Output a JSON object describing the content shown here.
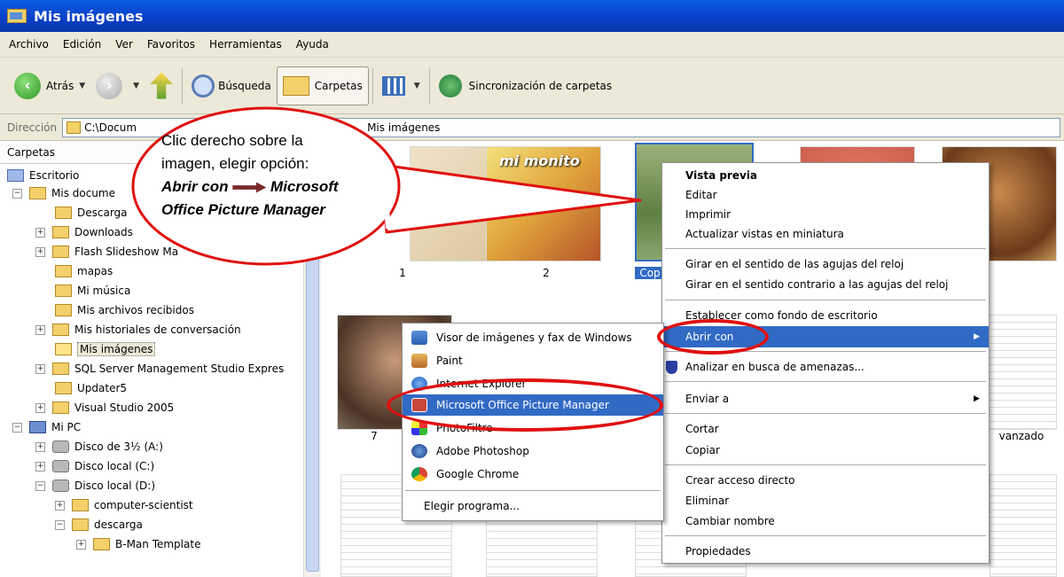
{
  "window": {
    "title": "Mis imágenes"
  },
  "menu": [
    "Archivo",
    "Edición",
    "Ver",
    "Favoritos",
    "Herramientas",
    "Ayuda"
  ],
  "toolbar": {
    "back_label": "Atrás",
    "search_label": "Búsqueda",
    "folders_label": "Carpetas",
    "sync_label": "Sincronización de carpetas"
  },
  "address": {
    "label": "Dirección",
    "path_start": "C:\\Docum",
    "path_end": "Mis imágenes"
  },
  "tree": {
    "header": "Carpetas",
    "items": [
      "Escritorio",
      "Mis docume",
      "Descarga",
      "Downloads",
      "Flash Slideshow Ma",
      "mapas",
      "Mi música",
      "Mis archivos recibidos",
      "Mis historiales de conversación",
      "Mis imágenes",
      "SQL Server Management Studio Expres",
      "Updater5",
      "Visual Studio 2005",
      "Mi PC",
      "Disco de 3½ (A:)",
      "Disco local (C:)",
      "Disco local (D:)",
      "computer-scientist",
      "descarga",
      "B-Man Template"
    ]
  },
  "thumbnails": {
    "captions": [
      "1",
      "2",
      "Cop",
      "7",
      "vanzado"
    ],
    "img2_text": "mi monito"
  },
  "context_menu": {
    "items": [
      "Vista previa",
      "Editar",
      "Imprimir",
      "Actualizar vistas en miniatura",
      "Girar en el sentido de las agujas del reloj",
      "Girar en el sentido contrario a las agujas del reloj",
      "Establecer como fondo de escritorio",
      "Abrir con",
      "Analizar en busca de amenazas...",
      "Enviar a",
      "Cortar",
      "Copiar",
      "Crear acceso directo",
      "Eliminar",
      "Cambiar nombre",
      "Propiedades"
    ]
  },
  "submenu": {
    "items": [
      "Visor de imágenes y fax de Windows",
      "Paint",
      "Internet Explorer",
      "Microsoft Office Picture Manager",
      "PhotoFiltre",
      "Adobe Photoshop",
      "Google Chrome",
      "Elegir programa..."
    ]
  },
  "callout": {
    "line1": "Clic  derecho sobre la",
    "line2": "imagen, elegir opción:",
    "line3a": "Abrir con",
    "line3b": "Microsoft",
    "line4": "Office Picture Manager"
  },
  "colors": {
    "highlight": "#316ac5",
    "annotation": "#e01010",
    "titlebar": "#0a4fd4"
  }
}
